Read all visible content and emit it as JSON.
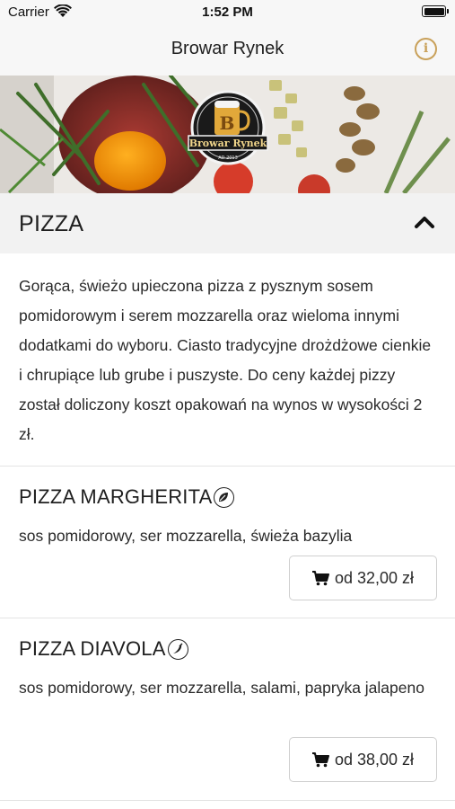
{
  "status_bar": {
    "carrier": "Carrier",
    "time": "1:52 PM"
  },
  "nav": {
    "title": "Browar Rynek",
    "info_icon": "info-icon"
  },
  "banner": {
    "logo_text": "Browar Rynek",
    "logo_sub": "AD 2013"
  },
  "category": {
    "title": "PIZZA",
    "collapse_icon": "chevron-up-icon",
    "description": "Gorąca, świeżo upieczona pizza z pysznym sosem pomidorowym i serem mozzarella oraz wieloma innymi dodatkami do wyboru. Ciasto tradycyjne drożdżowe cienkie i chrupiące lub grube i puszyste. Do ceny każdej pizzy został doliczony koszt opakowań na wynos w wysokości 2 zł."
  },
  "items": [
    {
      "name": "PIZZA MARGHERITA",
      "badge_icon": "vegetarian-leaf-icon",
      "description": " sos pomidorowy, ser mozzarella, świeża bazylia",
      "price_label": "od 32,00 zł"
    },
    {
      "name": "PIZZA DIAVOLA",
      "badge_icon": "spicy-chili-icon",
      "description": " sos pomidorowy, ser mozzarella, salami, papryka jalapeno",
      "price_label": "od 38,00 zł"
    }
  ],
  "colors": {
    "accent": "#c9a15a",
    "header_bg": "#f7f7f7",
    "category_bg": "#f2f2f2"
  }
}
